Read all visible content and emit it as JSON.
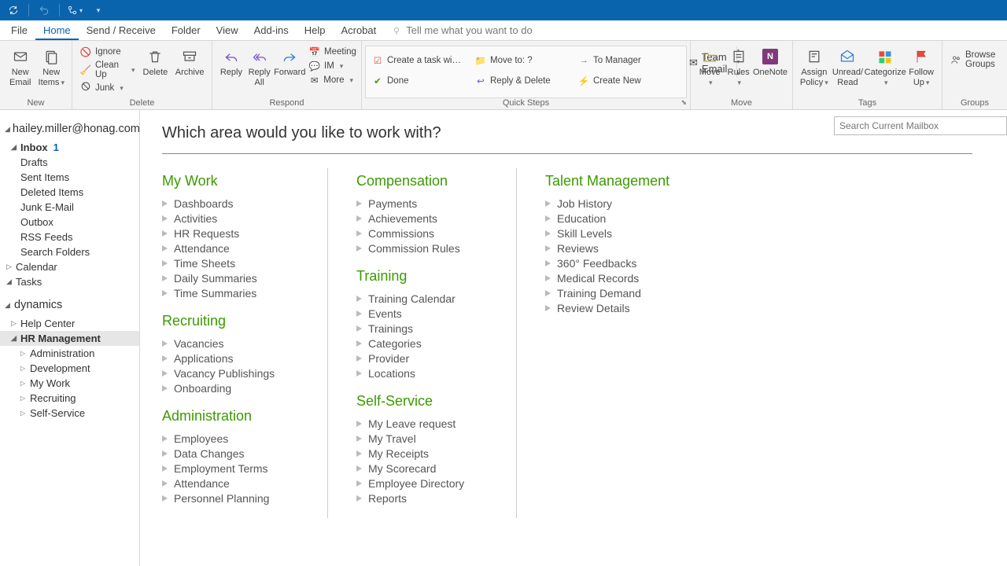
{
  "titlebar": {
    "tooltip_sync": "Sync",
    "tooltip_undo": "Undo"
  },
  "menu": {
    "tabs": [
      "File",
      "Home",
      "Send / Receive",
      "Folder",
      "View",
      "Add-ins",
      "Help",
      "Acrobat"
    ],
    "active_index": 1,
    "tell_me": "Tell me what you want to do"
  },
  "ribbon": {
    "new": {
      "label": "New",
      "new_email": "New\nEmail",
      "new_items": "New\nItems"
    },
    "delete": {
      "label": "Delete",
      "ignore": "Ignore",
      "cleanup": "Clean Up",
      "junk": "Junk",
      "delete": "Delete",
      "archive": "Archive"
    },
    "respond": {
      "label": "Respond",
      "reply": "Reply",
      "reply_all": "Reply\nAll",
      "forward": "Forward",
      "meeting": "Meeting",
      "im": "IM",
      "more": "More"
    },
    "quicksteps": {
      "label": "Quick Steps",
      "items": [
        "Create a task wi…",
        "Move to: ?",
        "To Manager",
        "Done",
        "Reply & Delete",
        "Create New"
      ],
      "team_email": "Team Email"
    },
    "move": {
      "label": "Move",
      "move": "Move",
      "rules": "Rules",
      "onenote": "OneNote"
    },
    "tags": {
      "label": "Tags",
      "assign": "Assign\nPolicy",
      "unread": "Unread/\nRead",
      "categorize": "Categorize",
      "followup": "Follow\nUp"
    },
    "groups": {
      "label": "Groups",
      "browse": "Browse Groups"
    }
  },
  "sidebar": {
    "account": "hailey.miller@honag.com",
    "inbox": {
      "label": "Inbox",
      "count": "1"
    },
    "folders": [
      "Drafts",
      "Sent Items",
      "Deleted Items",
      "Junk E-Mail",
      "Outbox",
      "RSS Feeds",
      "Search Folders"
    ],
    "calendar": "Calendar",
    "tasks": "Tasks",
    "dynamics": "dynamics",
    "help_center": "Help Center",
    "hr": "HR Management",
    "hr_children": [
      "Administration",
      "Development",
      "My Work",
      "Recruiting",
      "Self-Service"
    ]
  },
  "content": {
    "search_placeholder": "Search Current Mailbox",
    "question": "Which area would you like to work with?",
    "columns": [
      {
        "sections": [
          {
            "title": "My Work",
            "items": [
              "Dashboards",
              "Activities",
              "HR Requests",
              "Attendance",
              "Time Sheets",
              "Daily Summaries",
              "Time Summaries"
            ]
          },
          {
            "title": "Recruiting",
            "items": [
              "Vacancies",
              "Applications",
              "Vacancy Publishings",
              "Onboarding"
            ]
          },
          {
            "title": "Administration",
            "items": [
              "Employees",
              "Data Changes",
              "Employment Terms",
              "Attendance",
              "Personnel Planning"
            ]
          }
        ]
      },
      {
        "sections": [
          {
            "title": "Compensation",
            "items": [
              "Payments",
              "Achievements",
              "Commissions",
              "Commission Rules"
            ]
          },
          {
            "title": "Training",
            "items": [
              "Training Calendar",
              "Events",
              "Trainings",
              "Categories",
              "Provider",
              "Locations"
            ]
          },
          {
            "title": "Self-Service",
            "items": [
              "My Leave request",
              "My Travel",
              "My Receipts",
              "My Scorecard",
              "Employee Directory",
              "Reports"
            ]
          }
        ]
      },
      {
        "sections": [
          {
            "title": "Talent Management",
            "items": [
              "Job History",
              "Education",
              "Skill Levels",
              "Reviews",
              "360° Feedbacks",
              "Medical Records",
              "Training Demand",
              "Review Details"
            ]
          }
        ]
      }
    ]
  }
}
